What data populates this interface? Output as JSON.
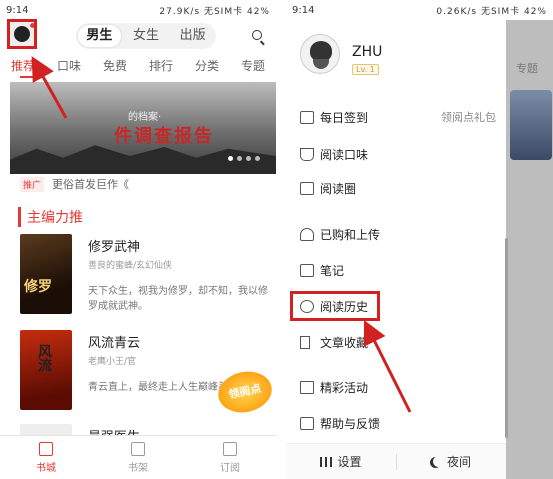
{
  "left": {
    "status": {
      "time": "9:14",
      "net": "27.9K/s",
      "carrier": "无SIM卡",
      "battery": "42%"
    },
    "gender_tabs": [
      {
        "label": "男生",
        "active": true
      },
      {
        "label": "女生",
        "active": false
      },
      {
        "label": "出版",
        "active": false
      }
    ],
    "nav_tabs": [
      {
        "label": "推荐",
        "active": true
      },
      {
        "label": "口味",
        "active": false
      },
      {
        "label": "免费",
        "active": false
      },
      {
        "label": "排行",
        "active": false
      },
      {
        "label": "分类",
        "active": false
      },
      {
        "label": "专题",
        "active": false
      }
    ],
    "banner": {
      "subtitle": "的档案·",
      "title": "件调查报告"
    },
    "banner_dots": 4,
    "promo": {
      "badge": "推广",
      "text": "更俗首发巨作《"
    },
    "section_title": "主编力推",
    "books": [
      {
        "title": "修罗武神",
        "author": "善良的蜜蜂/玄幻仙侠",
        "desc": "天下众生，视我为修罗，却不知，我以修罗成就武神。"
      },
      {
        "title": "风流青云",
        "author": "老鹰小王/官",
        "desc": "青云直上，最终走上人生巅峰美人归。"
      },
      {
        "title": "最强医生",
        "author": "",
        "desc": ""
      }
    ],
    "float_badge": "领阅点",
    "bottom_nav": [
      {
        "label": "书城",
        "active": true
      },
      {
        "label": "书架",
        "active": false
      },
      {
        "label": "订阅",
        "active": false
      }
    ]
  },
  "right": {
    "status": {
      "time": "9:14",
      "net": "0.26K/s",
      "carrier": "无SIM卡",
      "battery": "42%"
    },
    "peek_text": "专题",
    "user": {
      "name": "ZHU",
      "level": "Lv. 1"
    },
    "menu": [
      {
        "label": "每日签到",
        "right": "领阅点礼包",
        "icon": "calendar-icon"
      },
      {
        "label": "阅读口味",
        "right": "",
        "icon": "cup-icon"
      },
      {
        "label": "阅读圈",
        "right": "",
        "icon": "chat-icon"
      },
      {
        "label": "已购和上传",
        "right": "",
        "icon": "cloud-icon"
      },
      {
        "label": "笔记",
        "right": "",
        "icon": "note-icon"
      },
      {
        "label": "阅读历史",
        "right": "",
        "icon": "clock-icon"
      },
      {
        "label": "文章收藏",
        "right": "",
        "icon": "bookmark-icon"
      },
      {
        "label": "精彩活动",
        "right": "",
        "icon": "gift-icon"
      },
      {
        "label": "帮助与反馈",
        "right": "",
        "icon": "help-icon"
      }
    ],
    "bottom": {
      "settings": "设置",
      "night": "夜间"
    }
  },
  "colors": {
    "accent": "#e53935",
    "highlight_frame": "#d32020"
  }
}
